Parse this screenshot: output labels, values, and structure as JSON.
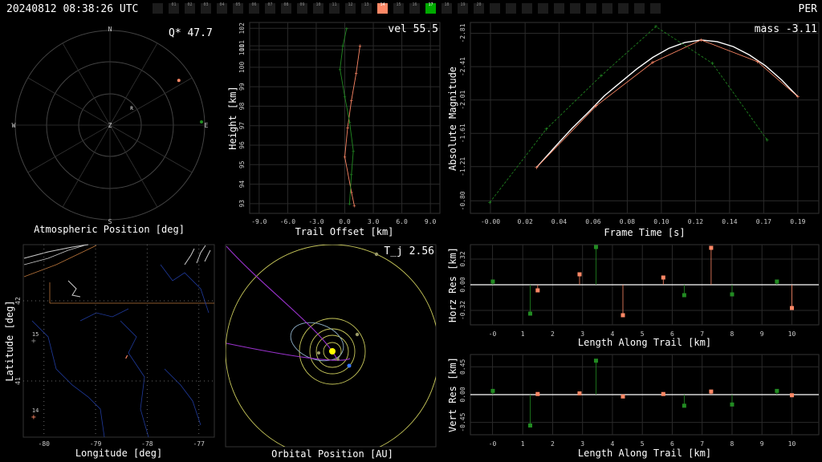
{
  "header": {
    "timestamp": "20240812 08:38:26 UTC",
    "shower": "PER",
    "stations": [
      {
        "label": "",
        "state": "off"
      },
      {
        "label": "01",
        "state": "off"
      },
      {
        "label": "02",
        "state": "off"
      },
      {
        "label": "03",
        "state": "off"
      },
      {
        "label": "04",
        "state": "off"
      },
      {
        "label": "05",
        "state": "off"
      },
      {
        "label": "06",
        "state": "off"
      },
      {
        "label": "07",
        "state": "off"
      },
      {
        "label": "08",
        "state": "off"
      },
      {
        "label": "09",
        "state": "off"
      },
      {
        "label": "10",
        "state": "off"
      },
      {
        "label": "11",
        "state": "off"
      },
      {
        "label": "12",
        "state": "off"
      },
      {
        "label": "13",
        "state": "off"
      },
      {
        "label": "14",
        "state": "active",
        "color": "#ff8866"
      },
      {
        "label": "15",
        "state": "off"
      },
      {
        "label": "16",
        "state": "off"
      },
      {
        "label": "17",
        "state": "active",
        "color": "#00aa00"
      },
      {
        "label": "18",
        "state": "off"
      },
      {
        "label": "19",
        "state": "off"
      },
      {
        "label": "20",
        "state": "off"
      },
      {
        "label": "",
        "state": "off"
      },
      {
        "label": "",
        "state": "off"
      },
      {
        "label": "",
        "state": "off"
      },
      {
        "label": "",
        "state": "off"
      },
      {
        "label": "",
        "state": "off"
      },
      {
        "label": "",
        "state": "off"
      },
      {
        "label": "",
        "state": "off"
      },
      {
        "label": "",
        "state": "off"
      },
      {
        "label": "",
        "state": "off"
      },
      {
        "label": "",
        "state": "off"
      },
      {
        "label": "",
        "state": "off"
      }
    ]
  },
  "colors": {
    "station14": "#ff8866",
    "station17": "#228b22",
    "fit": "#ffffff",
    "grid": "#2a2a2a",
    "orbit": "#c8c85a",
    "radiant_track": "#9932cc"
  },
  "chart_data": [
    {
      "type": "scatter",
      "id": "atmospheric",
      "title": "Atmospheric Position [deg]",
      "readout": "Q* 47.7",
      "compass": [
        "N",
        "E",
        "S",
        "W"
      ],
      "center_label": "Z",
      "radiant_label": "R",
      "series": [
        {
          "name": "14",
          "color": "#ff8866",
          "points": [
            [
              57,
              12
            ]
          ]
        },
        {
          "name": "17",
          "color": "#228b22",
          "points": [
            [
              88,
              3
            ]
          ]
        }
      ],
      "radiant": [
        66,
        55
      ]
    },
    {
      "type": "line",
      "id": "height",
      "readout": "vel 55.5",
      "xlabel": "Trail Offset [km]",
      "ylabel": "Height [km]",
      "x_ticks": [
        "-9.0",
        "-6.0",
        "-3.0",
        "0.0",
        "3.0",
        "6.0",
        "9.0"
      ],
      "y_ticks": [
        "93",
        "94",
        "95",
        "96",
        "97",
        "98",
        "99",
        "100",
        "101",
        "101",
        "102"
      ],
      "xlim": [
        -10,
        10
      ],
      "ylim": [
        92.5,
        102.3
      ],
      "series": [
        {
          "name": "14",
          "color": "#ff8866",
          "x": [
            1.0,
            0.7,
            0.0,
            0.3,
            0.7,
            1.2,
            1.6
          ],
          "y": [
            92.9,
            93.6,
            95.4,
            96.9,
            98.3,
            99.7,
            101.1
          ]
        },
        {
          "name": "17",
          "color": "#228b22",
          "x": [
            0.5,
            0.7,
            0.9,
            0.5,
            0.0,
            -0.5,
            -0.2,
            0.2
          ],
          "y": [
            93.0,
            94.5,
            95.7,
            97.2,
            98.5,
            99.9,
            101.1,
            102.0
          ]
        }
      ]
    },
    {
      "type": "line",
      "id": "magnitude",
      "readout": "mass -3.11",
      "xlabel": "Frame Time [s]",
      "ylabel": "Absolute Magnitude",
      "x_ticks": [
        "-0.00",
        "0.02",
        "0.04",
        "0.06",
        "0.08",
        "0.10",
        "0.12",
        "0.14",
        "0.17",
        "0.19"
      ],
      "y_ticks": [
        "-0.80",
        "-1.21",
        "-1.61",
        "-2.01",
        "-2.41",
        "-2.81"
      ],
      "xlim": [
        -0.01,
        0.195
      ],
      "ylim": [
        -0.65,
        -2.94
      ],
      "series": [
        {
          "name": "fit",
          "color": "#ffffff",
          "x": [
            0.028,
            0.04,
            0.05,
            0.06,
            0.07,
            0.08,
            0.09,
            0.1,
            0.11,
            0.12,
            0.13,
            0.14,
            0.15,
            0.16,
            0.17,
            0.18,
            0.19
          ],
          "y": [
            -1.2,
            -1.46,
            -1.67,
            -1.86,
            -2.06,
            -2.22,
            -2.38,
            -2.52,
            -2.63,
            -2.7,
            -2.73,
            -2.71,
            -2.65,
            -2.55,
            -2.42,
            -2.25,
            -2.05
          ]
        },
        {
          "name": "14",
          "color": "#ff8866",
          "x": [
            0.028,
            0.065,
            0.1,
            0.13,
            0.165,
            0.19
          ],
          "y": [
            -1.2,
            -1.94,
            -2.46,
            -2.73,
            -2.47,
            -2.05
          ]
        },
        {
          "name": "17",
          "color": "#228b22",
          "x": [
            -0.001,
            0.034,
            0.068,
            0.102,
            0.137,
            0.171
          ],
          "y": [
            -0.78,
            -1.66,
            -2.3,
            -2.89,
            -2.45,
            -1.53
          ]
        }
      ]
    },
    {
      "type": "map",
      "id": "ground",
      "xlabel": "Longitude [deg]",
      "ylabel": "Latitude [deg]",
      "x_ticks": [
        "-80",
        "-79",
        "-78",
        "-77"
      ],
      "y_ticks": [
        "42",
        "41"
      ],
      "xlim": [
        -80.4,
        -76.7
      ],
      "ylim": [
        40.3,
        42.7
      ],
      "stations": [
        {
          "name": "15",
          "lon": -80.2,
          "lat": 41.5,
          "color": "#888888"
        },
        {
          "name": "14",
          "lon": -80.2,
          "lat": 40.55,
          "color": "#ff8866"
        }
      ],
      "trail": {
        "lon": -78.4,
        "lat": 41.3,
        "color": "#ff8866"
      }
    },
    {
      "type": "orbit",
      "id": "orbital",
      "readout": "T_j 2.56",
      "xlabel": "Orbital Position [AU]"
    },
    {
      "type": "scatter",
      "id": "horz_res",
      "xlabel": "Length Along Trail [km]",
      "ylabel": "Horz Res [km]",
      "x_ticks": [
        "-0",
        "1",
        "2",
        "3",
        "4",
        "5",
        "6",
        "7",
        "8",
        "9",
        "10"
      ],
      "y_ticks": [
        "-0.32",
        "0.00",
        "0.32"
      ],
      "xlim": [
        -0.75,
        10.9
      ],
      "ylim": [
        -0.5,
        0.5
      ],
      "series": [
        {
          "name": "14",
          "color": "#ff8866",
          "x": [
            1.5,
            2.9,
            4.35,
            5.7,
            7.3,
            10.0
          ],
          "y": [
            -0.07,
            0.13,
            -0.38,
            0.09,
            0.46,
            -0.29
          ]
        },
        {
          "name": "17",
          "color": "#228b22",
          "x": [
            0.0,
            1.25,
            3.45,
            6.4,
            8.0,
            9.5
          ],
          "y": [
            0.04,
            -0.36,
            0.47,
            -0.13,
            -0.12,
            0.04
          ]
        }
      ]
    },
    {
      "type": "scatter",
      "id": "vert_res",
      "xlabel": "Length Along Trail [km]",
      "ylabel": "Vert Res [km]",
      "x_ticks": [
        "-0",
        "1",
        "2",
        "3",
        "4",
        "5",
        "6",
        "7",
        "8",
        "9",
        "10"
      ],
      "y_ticks": [
        "-0.45",
        "0.00",
        "0.45"
      ],
      "xlim": [
        -0.75,
        10.9
      ],
      "ylim": [
        -0.65,
        0.65
      ],
      "series": [
        {
          "name": "14",
          "color": "#ff8866",
          "x": [
            1.5,
            2.9,
            4.35,
            5.7,
            7.3,
            10.0
          ],
          "y": [
            0.01,
            0.02,
            -0.03,
            0.01,
            0.05,
            -0.01
          ]
        },
        {
          "name": "17",
          "color": "#228b22",
          "x": [
            0.0,
            1.25,
            3.45,
            6.4,
            8.0,
            9.5
          ],
          "y": [
            0.06,
            -0.5,
            0.55,
            -0.18,
            -0.16,
            0.06
          ]
        }
      ]
    }
  ]
}
